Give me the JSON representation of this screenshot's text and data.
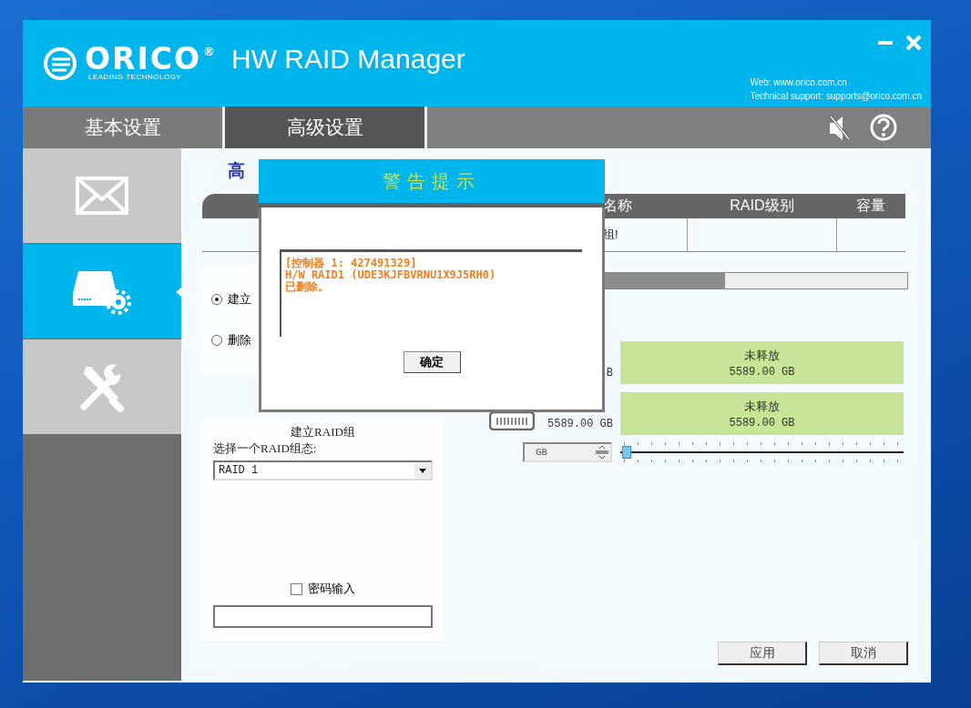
{
  "window": {
    "brand": "ORICO",
    "brand_mark": "®",
    "brand_tagline": "LEADING TECHNOLOGY",
    "title": "HW RAID Manager",
    "web": "Web: www.orico.com.cn",
    "support": "Technical support: supports@orico.com.cn"
  },
  "tabs": [
    {
      "label": "基本设置",
      "selected": false
    },
    {
      "label": "高级设置",
      "selected": true
    }
  ],
  "sidebar": {
    "items": [
      {
        "kind": "mail",
        "selected": false
      },
      {
        "kind": "drive",
        "selected": true
      },
      {
        "kind": "tools",
        "selected": false
      }
    ]
  },
  "panel": {
    "heading": "高",
    "raid_table": {
      "columns": [
        "名称",
        "RAID级别",
        "容量"
      ],
      "rows": [
        {
          "name": "组!"
        }
      ]
    },
    "options": [
      {
        "label": "建立",
        "selected": true
      },
      {
        "label": "删除",
        "selected": false
      }
    ],
    "usage_bar": {
      "level": 0.59
    },
    "disks": [
      {
        "kind": "text",
        "capacity": "B",
        "status": "未释放",
        "free": "5589.00 GB"
      },
      {
        "kind": "drive",
        "capacity": "5589.00 GB",
        "status": "未释放",
        "free": "5589.00 GB"
      }
    ],
    "size_unit": "GB",
    "size_slider": {
      "level": 0
    },
    "create_group": {
      "title": "建立RAID组",
      "mode_label": "选择一个RAID组态:",
      "mode_value": "RAID 1",
      "password": {
        "label": "密码输入",
        "checked": false
      }
    },
    "buttons": [
      "应用",
      "取消"
    ]
  },
  "dialog": {
    "title": "警告提示",
    "message": "[控制器 1: 427491329]\nH/W RAID1 (UDE3KJFBVRNU1X9J5RH0)\n已删除。",
    "button": "确定"
  }
}
